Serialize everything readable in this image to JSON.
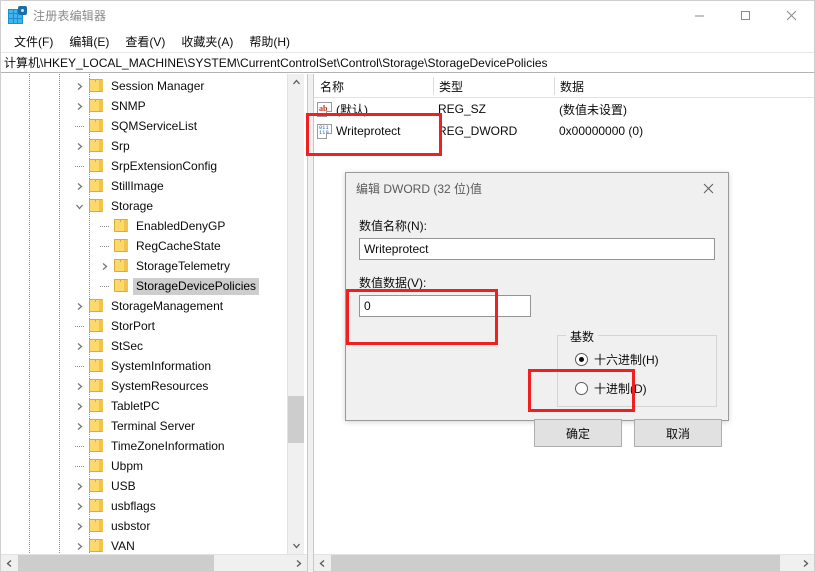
{
  "window": {
    "title": "注册表编辑器",
    "icon": "registry-editor-icon",
    "minimize_label": "—",
    "maximize_label": "□",
    "close_label": "✕"
  },
  "menubar": {
    "items": [
      {
        "label": "文件(F)"
      },
      {
        "label": "编辑(E)"
      },
      {
        "label": "查看(V)"
      },
      {
        "label": "收藏夹(A)"
      },
      {
        "label": "帮助(H)"
      }
    ]
  },
  "address": {
    "path": "计算机\\HKEY_LOCAL_MACHINE\\SYSTEM\\CurrentControlSet\\Control\\Storage\\StorageDevicePolicies"
  },
  "tree": {
    "items": [
      {
        "label": "Session Manager",
        "depth": 3,
        "expandable": true,
        "expanded": false,
        "selected": false
      },
      {
        "label": "SNMP",
        "depth": 3,
        "expandable": true,
        "expanded": false,
        "selected": false
      },
      {
        "label": "SQMServiceList",
        "depth": 3,
        "expandable": false,
        "expanded": false,
        "selected": false
      },
      {
        "label": "Srp",
        "depth": 3,
        "expandable": true,
        "expanded": false,
        "selected": false
      },
      {
        "label": "SrpExtensionConfig",
        "depth": 3,
        "expandable": false,
        "expanded": false,
        "selected": false
      },
      {
        "label": "StillImage",
        "depth": 3,
        "expandable": true,
        "expanded": false,
        "selected": false
      },
      {
        "label": "Storage",
        "depth": 3,
        "expandable": true,
        "expanded": true,
        "selected": false
      },
      {
        "label": "EnabledDenyGP",
        "depth": 4,
        "expandable": false,
        "expanded": false,
        "selected": false
      },
      {
        "label": "RegCacheState",
        "depth": 4,
        "expandable": false,
        "expanded": false,
        "selected": false
      },
      {
        "label": "StorageTelemetry",
        "depth": 4,
        "expandable": true,
        "expanded": false,
        "selected": false
      },
      {
        "label": "StorageDevicePolicies",
        "depth": 4,
        "expandable": false,
        "expanded": false,
        "selected": true
      },
      {
        "label": "StorageManagement",
        "depth": 3,
        "expandable": true,
        "expanded": false,
        "selected": false
      },
      {
        "label": "StorPort",
        "depth": 3,
        "expandable": false,
        "expanded": false,
        "selected": false
      },
      {
        "label": "StSec",
        "depth": 3,
        "expandable": true,
        "expanded": false,
        "selected": false
      },
      {
        "label": "SystemInformation",
        "depth": 3,
        "expandable": false,
        "expanded": false,
        "selected": false
      },
      {
        "label": "SystemResources",
        "depth": 3,
        "expandable": true,
        "expanded": false,
        "selected": false
      },
      {
        "label": "TabletPC",
        "depth": 3,
        "expandable": true,
        "expanded": false,
        "selected": false
      },
      {
        "label": "Terminal Server",
        "depth": 3,
        "expandable": true,
        "expanded": false,
        "selected": false
      },
      {
        "label": "TimeZoneInformation",
        "depth": 3,
        "expandable": false,
        "expanded": false,
        "selected": false
      },
      {
        "label": "Ubpm",
        "depth": 3,
        "expandable": false,
        "expanded": false,
        "selected": false
      },
      {
        "label": "USB",
        "depth": 3,
        "expandable": true,
        "expanded": false,
        "selected": false
      },
      {
        "label": "usbflags",
        "depth": 3,
        "expandable": true,
        "expanded": false,
        "selected": false
      },
      {
        "label": "usbstor",
        "depth": 3,
        "expandable": true,
        "expanded": false,
        "selected": false
      },
      {
        "label": "VAN",
        "depth": 3,
        "expandable": true,
        "expanded": false,
        "selected": false
      }
    ]
  },
  "values_list": {
    "columns": [
      {
        "label": "名称"
      },
      {
        "label": "类型"
      },
      {
        "label": "数据"
      }
    ],
    "rows": [
      {
        "icon": "string-value-icon",
        "icon_text": "ab",
        "name": "(默认)",
        "type": "REG_SZ",
        "data": "(数值未设置)"
      },
      {
        "icon": "dword-value-icon",
        "icon_text": "011 110",
        "name": "Writeprotect",
        "type": "REG_DWORD",
        "data": "0x00000000 (0)"
      }
    ]
  },
  "dialog": {
    "title": "编辑 DWORD (32 位)值",
    "close_label": "✕",
    "value_name_label": "数值名称(N):",
    "value_name": "Writeprotect",
    "value_data_label": "数值数据(V):",
    "value_data": "0",
    "base_group_label": "基数",
    "radios": [
      {
        "label": "十六进制(H)",
        "selected": true
      },
      {
        "label": "十进制(D)",
        "selected": false
      }
    ],
    "ok_label": "确定",
    "cancel_label": "取消"
  },
  "scrollbars": {
    "up_arrow": "⌃",
    "down_arrow": "⌄",
    "left_arrow": "❮",
    "right_arrow": "❯"
  },
  "annotations": {
    "highlight_color": "#ef2020",
    "boxes": [
      {
        "name": "writeprotect-row-highlight"
      },
      {
        "name": "value-data-field-highlight"
      },
      {
        "name": "ok-button-highlight"
      }
    ]
  }
}
